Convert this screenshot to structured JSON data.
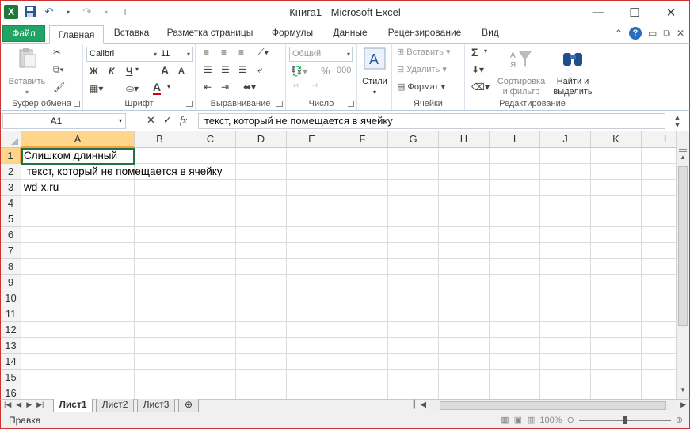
{
  "window": {
    "title": "Книга1 - Microsoft Excel",
    "minimize": "—",
    "maximize": "☐",
    "close": "✕"
  },
  "tabs": [
    {
      "label": "Файл"
    },
    {
      "label": "Главная"
    },
    {
      "label": "Вставка"
    },
    {
      "label": "Разметка страницы"
    },
    {
      "label": "Формулы"
    },
    {
      "label": "Данные"
    },
    {
      "label": "Рецензирование"
    },
    {
      "label": "Вид"
    }
  ],
  "ribbon": {
    "clipboard": {
      "paste": "Вставить",
      "group": "Буфер обмена"
    },
    "font": {
      "name": "Calibri",
      "size": "11",
      "bold": "Ж",
      "italic": "К",
      "underline": "Ч",
      "grow": "A",
      "shrink": "A",
      "color_letter": "A",
      "group": "Шрифт"
    },
    "alignment": {
      "group": "Выравнивание"
    },
    "number": {
      "format": "Общий",
      "percent": "%",
      "thousands": "000",
      "group": "Число"
    },
    "styles": {
      "label": "Стили"
    },
    "cells": {
      "insert": "Вставить",
      "delete": "Удалить",
      "format": "Формат",
      "group": "Ячейки"
    },
    "editing": {
      "sum": "Σ",
      "sort": "Сортировка",
      "sort2": "и фильтр",
      "find": "Найти и",
      "find2": "выделить",
      "group": "Редактирование"
    }
  },
  "formula_bar": {
    "name_box": "A1",
    "fx": "fx",
    "content": "текст, который не помещается в ячейку"
  },
  "columns": [
    "A",
    "B",
    "C",
    "D",
    "E",
    "F",
    "G",
    "H",
    "I",
    "J",
    "K",
    "L"
  ],
  "rows": [
    "1",
    "2",
    "3",
    "4",
    "5",
    "6",
    "7",
    "8",
    "9",
    "10",
    "11",
    "12",
    "13",
    "14",
    "15",
    "16"
  ],
  "cells": {
    "A1": "Слишком длинный",
    "A2": " текст, который не помещается в ячейку",
    "A3": "wd-x.ru"
  },
  "sheets": [
    {
      "label": "Лист1",
      "active": true
    },
    {
      "label": "Лист2",
      "active": false
    },
    {
      "label": "Лист3",
      "active": false
    }
  ],
  "status": {
    "mode": "Правка",
    "zoom": "100%"
  },
  "colors": {
    "accent": "#217346",
    "file_tab": "#21a366",
    "selected_header": "#ffd58c"
  }
}
